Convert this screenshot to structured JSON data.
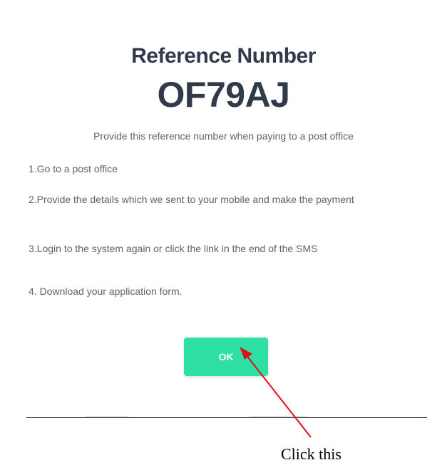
{
  "dialog": {
    "heading": "Reference Number",
    "reference_code": "OF79AJ",
    "subtitle": "Provide this reference number when paying to a post office",
    "steps": [
      "1.Go to a post office",
      "2.Provide the details which we sent to your mobile and make the payment",
      "3.Login to the system again or click the link in the end of the SMS",
      "4. Download your application form."
    ],
    "ok_label": "OK",
    "ok_color": "#2ee0a3"
  },
  "annotation": {
    "label": "Click this",
    "arrow_color": "#e0101a"
  }
}
